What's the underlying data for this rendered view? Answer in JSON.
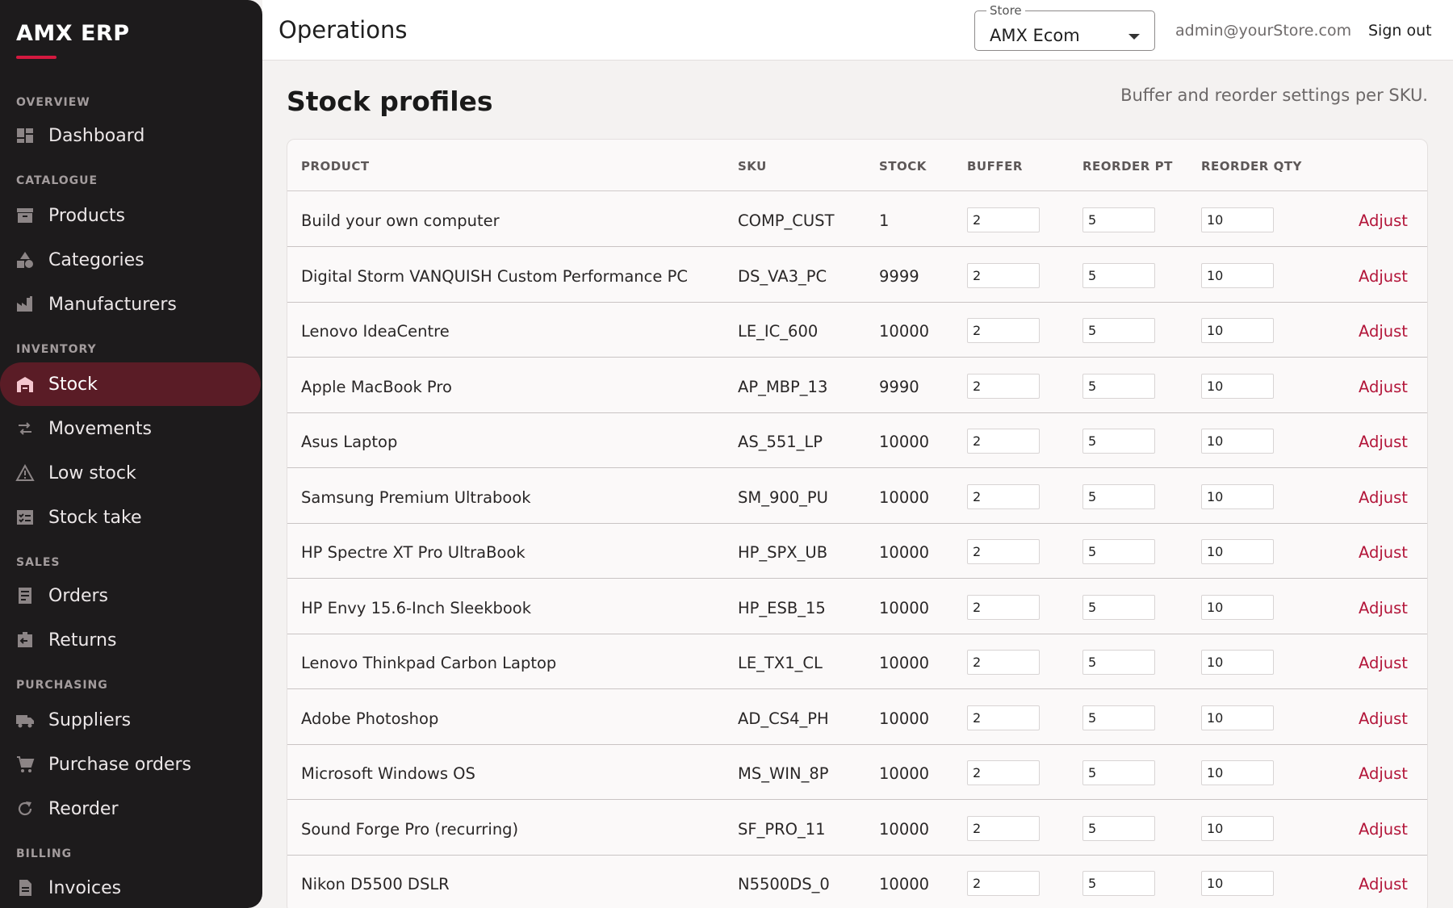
{
  "brand": {
    "name": "AMX ERP",
    "accent": "#d3193f"
  },
  "sidebar": {
    "sections": [
      {
        "label": "OVERVIEW"
      },
      {
        "label": "CATALOGUE"
      },
      {
        "label": "INVENTORY"
      },
      {
        "label": "SALES"
      },
      {
        "label": "PURCHASING"
      },
      {
        "label": "BILLING"
      }
    ],
    "items": [
      {
        "label": "Dashboard",
        "icon": "dashboard-icon"
      },
      {
        "label": "Products",
        "icon": "archive-icon"
      },
      {
        "label": "Categories",
        "icon": "shapes-icon"
      },
      {
        "label": "Manufacturers",
        "icon": "factory-icon"
      },
      {
        "label": "Stock",
        "icon": "warehouse-icon",
        "active": true
      },
      {
        "label": "Movements",
        "icon": "swap-icon"
      },
      {
        "label": "Low stock",
        "icon": "warning-icon"
      },
      {
        "label": "Stock take",
        "icon": "checklist-icon"
      },
      {
        "label": "Orders",
        "icon": "receipt-icon"
      },
      {
        "label": "Returns",
        "icon": "return-box-icon"
      },
      {
        "label": "Suppliers",
        "icon": "truck-icon"
      },
      {
        "label": "Purchase orders",
        "icon": "cart-icon"
      },
      {
        "label": "Reorder",
        "icon": "refresh-icon"
      },
      {
        "label": "Invoices",
        "icon": "document-icon"
      }
    ]
  },
  "header": {
    "title": "Operations",
    "store_label": "Store",
    "store_value": "AMX Ecom",
    "user_email": "admin@yourStore.com",
    "signout_label": "Sign out"
  },
  "main": {
    "title": "Stock profiles",
    "subtitle": "Buffer and reorder settings per SKU.",
    "columns": [
      "PRODUCT",
      "SKU",
      "STOCK",
      "BUFFER",
      "REORDER PT",
      "REORDER QTY"
    ],
    "action_label": "Adjust",
    "rows": [
      {
        "product": "Build your own computer",
        "sku": "COMP_CUST",
        "stock": "1",
        "buffer": "2",
        "reorder_pt": "5",
        "reorder_qty": "10"
      },
      {
        "product": "Digital Storm VANQUISH Custom Performance PC",
        "sku": "DS_VA3_PC",
        "stock": "9999",
        "buffer": "2",
        "reorder_pt": "5",
        "reorder_qty": "10"
      },
      {
        "product": "Lenovo IdeaCentre",
        "sku": "LE_IC_600",
        "stock": "10000",
        "buffer": "2",
        "reorder_pt": "5",
        "reorder_qty": "10"
      },
      {
        "product": "Apple MacBook Pro",
        "sku": "AP_MBP_13",
        "stock": "9990",
        "buffer": "2",
        "reorder_pt": "5",
        "reorder_qty": "10"
      },
      {
        "product": "Asus Laptop",
        "sku": "AS_551_LP",
        "stock": "10000",
        "buffer": "2",
        "reorder_pt": "5",
        "reorder_qty": "10"
      },
      {
        "product": "Samsung Premium Ultrabook",
        "sku": "SM_900_PU",
        "stock": "10000",
        "buffer": "2",
        "reorder_pt": "5",
        "reorder_qty": "10"
      },
      {
        "product": "HP Spectre XT Pro UltraBook",
        "sku": "HP_SPX_UB",
        "stock": "10000",
        "buffer": "2",
        "reorder_pt": "5",
        "reorder_qty": "10"
      },
      {
        "product": "HP Envy 15.6-Inch Sleekbook",
        "sku": "HP_ESB_15",
        "stock": "10000",
        "buffer": "2",
        "reorder_pt": "5",
        "reorder_qty": "10"
      },
      {
        "product": "Lenovo Thinkpad Carbon Laptop",
        "sku": "LE_TX1_CL",
        "stock": "10000",
        "buffer": "2",
        "reorder_pt": "5",
        "reorder_qty": "10"
      },
      {
        "product": "Adobe Photoshop",
        "sku": "AD_CS4_PH",
        "stock": "10000",
        "buffer": "2",
        "reorder_pt": "5",
        "reorder_qty": "10"
      },
      {
        "product": "Microsoft Windows OS",
        "sku": "MS_WIN_8P",
        "stock": "10000",
        "buffer": "2",
        "reorder_pt": "5",
        "reorder_qty": "10"
      },
      {
        "product": "Sound Forge Pro (recurring)",
        "sku": "SF_PRO_11",
        "stock": "10000",
        "buffer": "2",
        "reorder_pt": "5",
        "reorder_qty": "10"
      },
      {
        "product": "Nikon D5500 DSLR",
        "sku": "N5500DS_0",
        "stock": "10000",
        "buffer": "2",
        "reorder_pt": "5",
        "reorder_qty": "10"
      }
    ]
  }
}
